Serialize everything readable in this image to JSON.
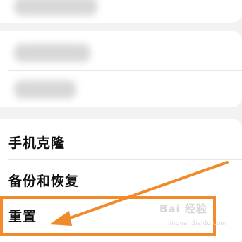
{
  "settings": {
    "top_row": {
      "label": ""
    },
    "middle_rows": [
      {
        "label": ""
      },
      {
        "label": ""
      }
    ],
    "items": [
      {
        "label": "手机克隆"
      },
      {
        "label": "备份和恢复"
      },
      {
        "label": "重置"
      }
    ]
  },
  "annotation": {
    "highlight_color": "#f08a2a",
    "highlight_target": "重置"
  },
  "watermark": {
    "text": "Bai 经验",
    "sub": "jingyan.baidu.com"
  }
}
